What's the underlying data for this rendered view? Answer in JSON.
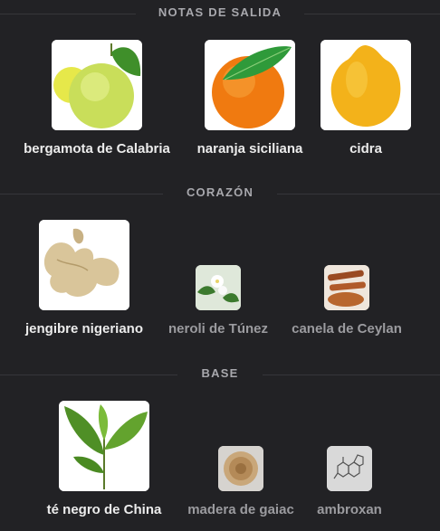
{
  "sections": [
    {
      "title": "NOTAS DE SALIDA",
      "notes": [
        {
          "label": "bergamota de Calabria",
          "image": "bergamot-image",
          "emphasis": true
        },
        {
          "label": "naranja siciliana",
          "image": "orange-image",
          "emphasis": true
        },
        {
          "label": "cidra",
          "image": "citron-image",
          "emphasis": true
        }
      ]
    },
    {
      "title": "CORAZÓN",
      "notes": [
        {
          "label": "jengibre nigeriano",
          "image": "ginger-image",
          "emphasis": true
        },
        {
          "label": "neroli de Túnez",
          "image": "neroli-image",
          "emphasis": false
        },
        {
          "label": "canela de Ceylan",
          "image": "cinnamon-image",
          "emphasis": false
        }
      ]
    },
    {
      "title": "BASE",
      "notes": [
        {
          "label": "té negro de China",
          "image": "tea-leaves-image",
          "emphasis": true
        },
        {
          "label": "madera de gaiac",
          "image": "guaiac-wood-image",
          "emphasis": false
        },
        {
          "label": "ambroxan",
          "image": "ambroxan-molecule-image",
          "emphasis": false
        }
      ]
    }
  ]
}
